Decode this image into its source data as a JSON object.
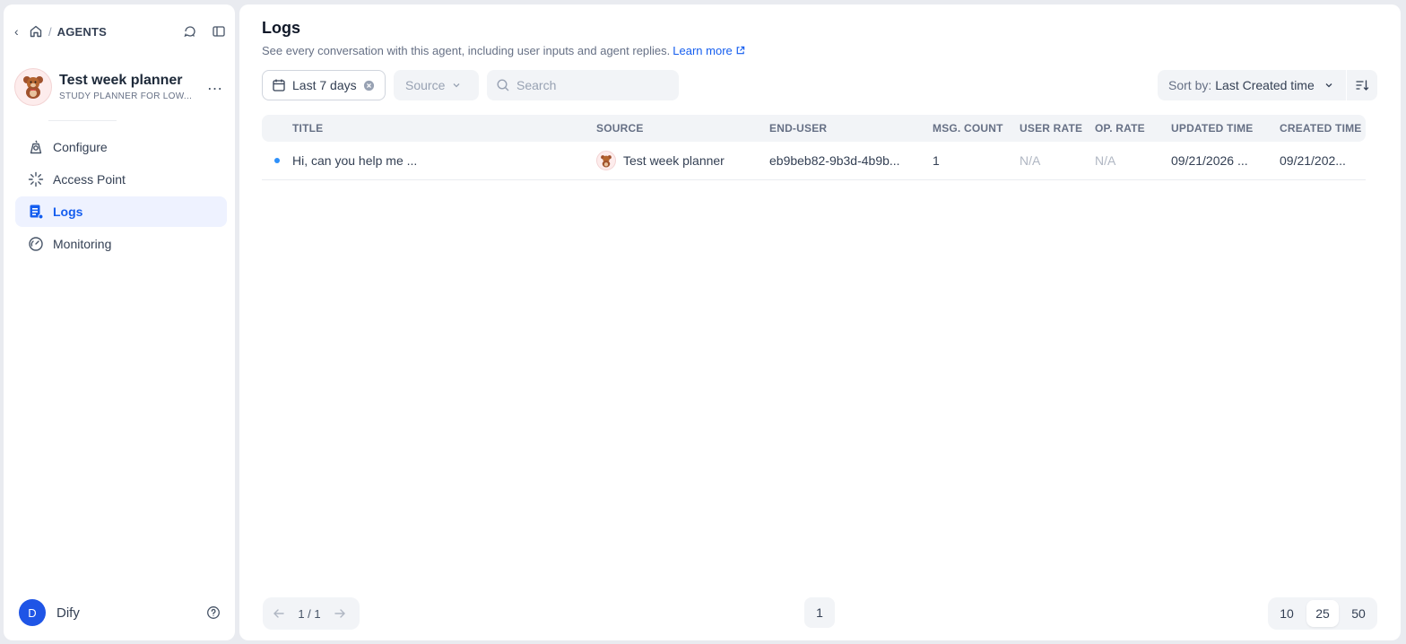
{
  "sidebar": {
    "breadcrumb": {
      "title": "AGENTS"
    },
    "app": {
      "name": "Test week planner",
      "description": "STUDY PLANNER FOR LOW..."
    },
    "nav": [
      {
        "label": "Configure",
        "icon": "configure-icon",
        "active": false
      },
      {
        "label": "Access Point",
        "icon": "access-point-icon",
        "active": false
      },
      {
        "label": "Logs",
        "icon": "logs-icon",
        "active": true
      },
      {
        "label": "Monitoring",
        "icon": "monitoring-icon",
        "active": false
      }
    ],
    "user": {
      "initial": "D",
      "name": "Dify"
    }
  },
  "main": {
    "title": "Logs",
    "description": "See every conversation with this agent, including user inputs and agent replies.",
    "learn_more": "Learn more",
    "filters": {
      "date": "Last 7 days",
      "source_placeholder": "Source",
      "search_placeholder": "Search"
    },
    "sort": {
      "label": "Sort by:",
      "value": "Last Created time"
    },
    "table": {
      "headers": [
        "TITLE",
        "SOURCE",
        "END-USER",
        "MSG. COUNT",
        "USER RATE",
        "OP. RATE",
        "UPDATED TIME",
        "CREATED TIME"
      ],
      "rows": [
        {
          "title": "Hi, can you help me ...",
          "source": "Test week planner",
          "end_user": "eb9beb82-9b3d-4b9b...",
          "msg_count": "1",
          "user_rate": "N/A",
          "op_rate": "N/A",
          "updated": "09/21/2026 ...",
          "created": "09/21/202..."
        }
      ]
    },
    "pagination": {
      "page_info": "1 / 1",
      "current_page": "1",
      "sizes": [
        "10",
        "25",
        "50"
      ],
      "active_size": "25"
    }
  },
  "colors": {
    "accent": "#155eef",
    "active_bg": "#eef2ff",
    "avatar_blue": "#1f55e6",
    "unread_dot": "#2e90fa"
  }
}
